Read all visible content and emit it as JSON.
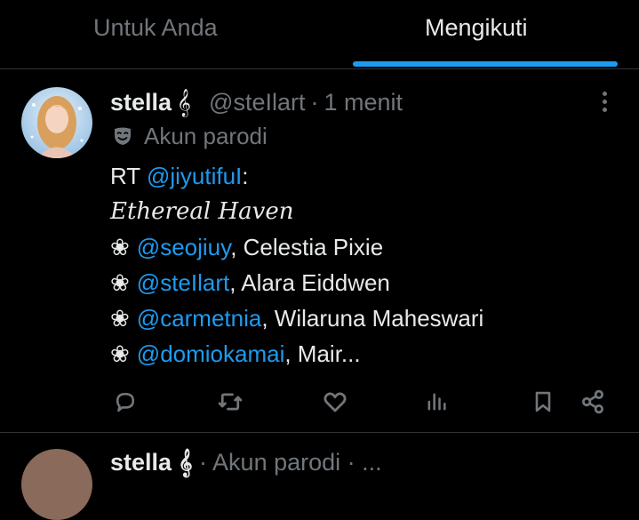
{
  "tabs": [
    {
      "label": "Untuk Anda",
      "active": false
    },
    {
      "label": "Mengikuti",
      "active": true
    }
  ],
  "colors": {
    "accent": "#1d9bf0",
    "muted": "#71767b",
    "text": "#e7e9ea",
    "background": "#000000"
  },
  "tweet": {
    "name": "stella",
    "name_badge": "𝄞",
    "handle": "@steIlart",
    "separator": "·",
    "time": "1 menit",
    "label": "Akun parodi",
    "label_icon": "parody-mask-icon",
    "lines": {
      "rt_prefix": "RT",
      "rt_mention": "@jiyutifuI",
      "rt_colon": ":",
      "title": "Ethereal Haven",
      "bullet": "❀",
      "item1_mention": "@seojiuy",
      "item1_text": ", Celestia Pixie",
      "item2_mention": "@steIlart",
      "item2_text": ", Alara Eiddwen",
      "item3_mention": "@carmetnia",
      "item3_text": ", Wilaruna Maheswari",
      "item4_mention": "@domiokamai",
      "item4_text": ", Mair..."
    },
    "actions": [
      "reply-icon",
      "retweet-icon",
      "like-icon",
      "views-icon",
      "bookmark-icon",
      "share-icon"
    ]
  },
  "next_tweet": {
    "name": "stella",
    "name_badge": "𝄞",
    "rest": "  · Akun parodi · ..."
  }
}
